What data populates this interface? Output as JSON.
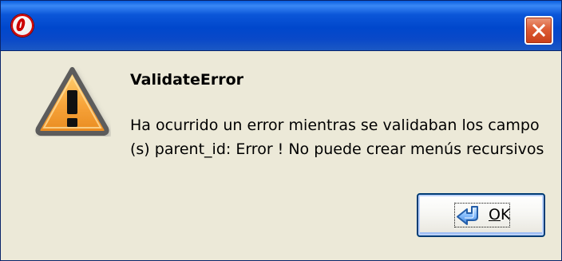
{
  "window": {
    "title": "",
    "icon": "opera-o-icon",
    "close_icon": "close-icon"
  },
  "message": {
    "title": "ValidateError",
    "line1": "Ha ocurrido un error mientras se validaban los campo",
    "line2": "(s) parent_id: Error ! No puede crear menús recursivos",
    "icon": "warning-icon"
  },
  "actions": {
    "ok_mnemonic": "O",
    "ok_rest": "K",
    "ok_icon": "ok-arrow-icon"
  },
  "colors": {
    "title_bar_blue": "#0a5fe0",
    "dialog_background": "#ece9d8",
    "warning_orange": "#f7a43a",
    "close_red": "#dd5c35",
    "button_blue": "#003c74"
  }
}
